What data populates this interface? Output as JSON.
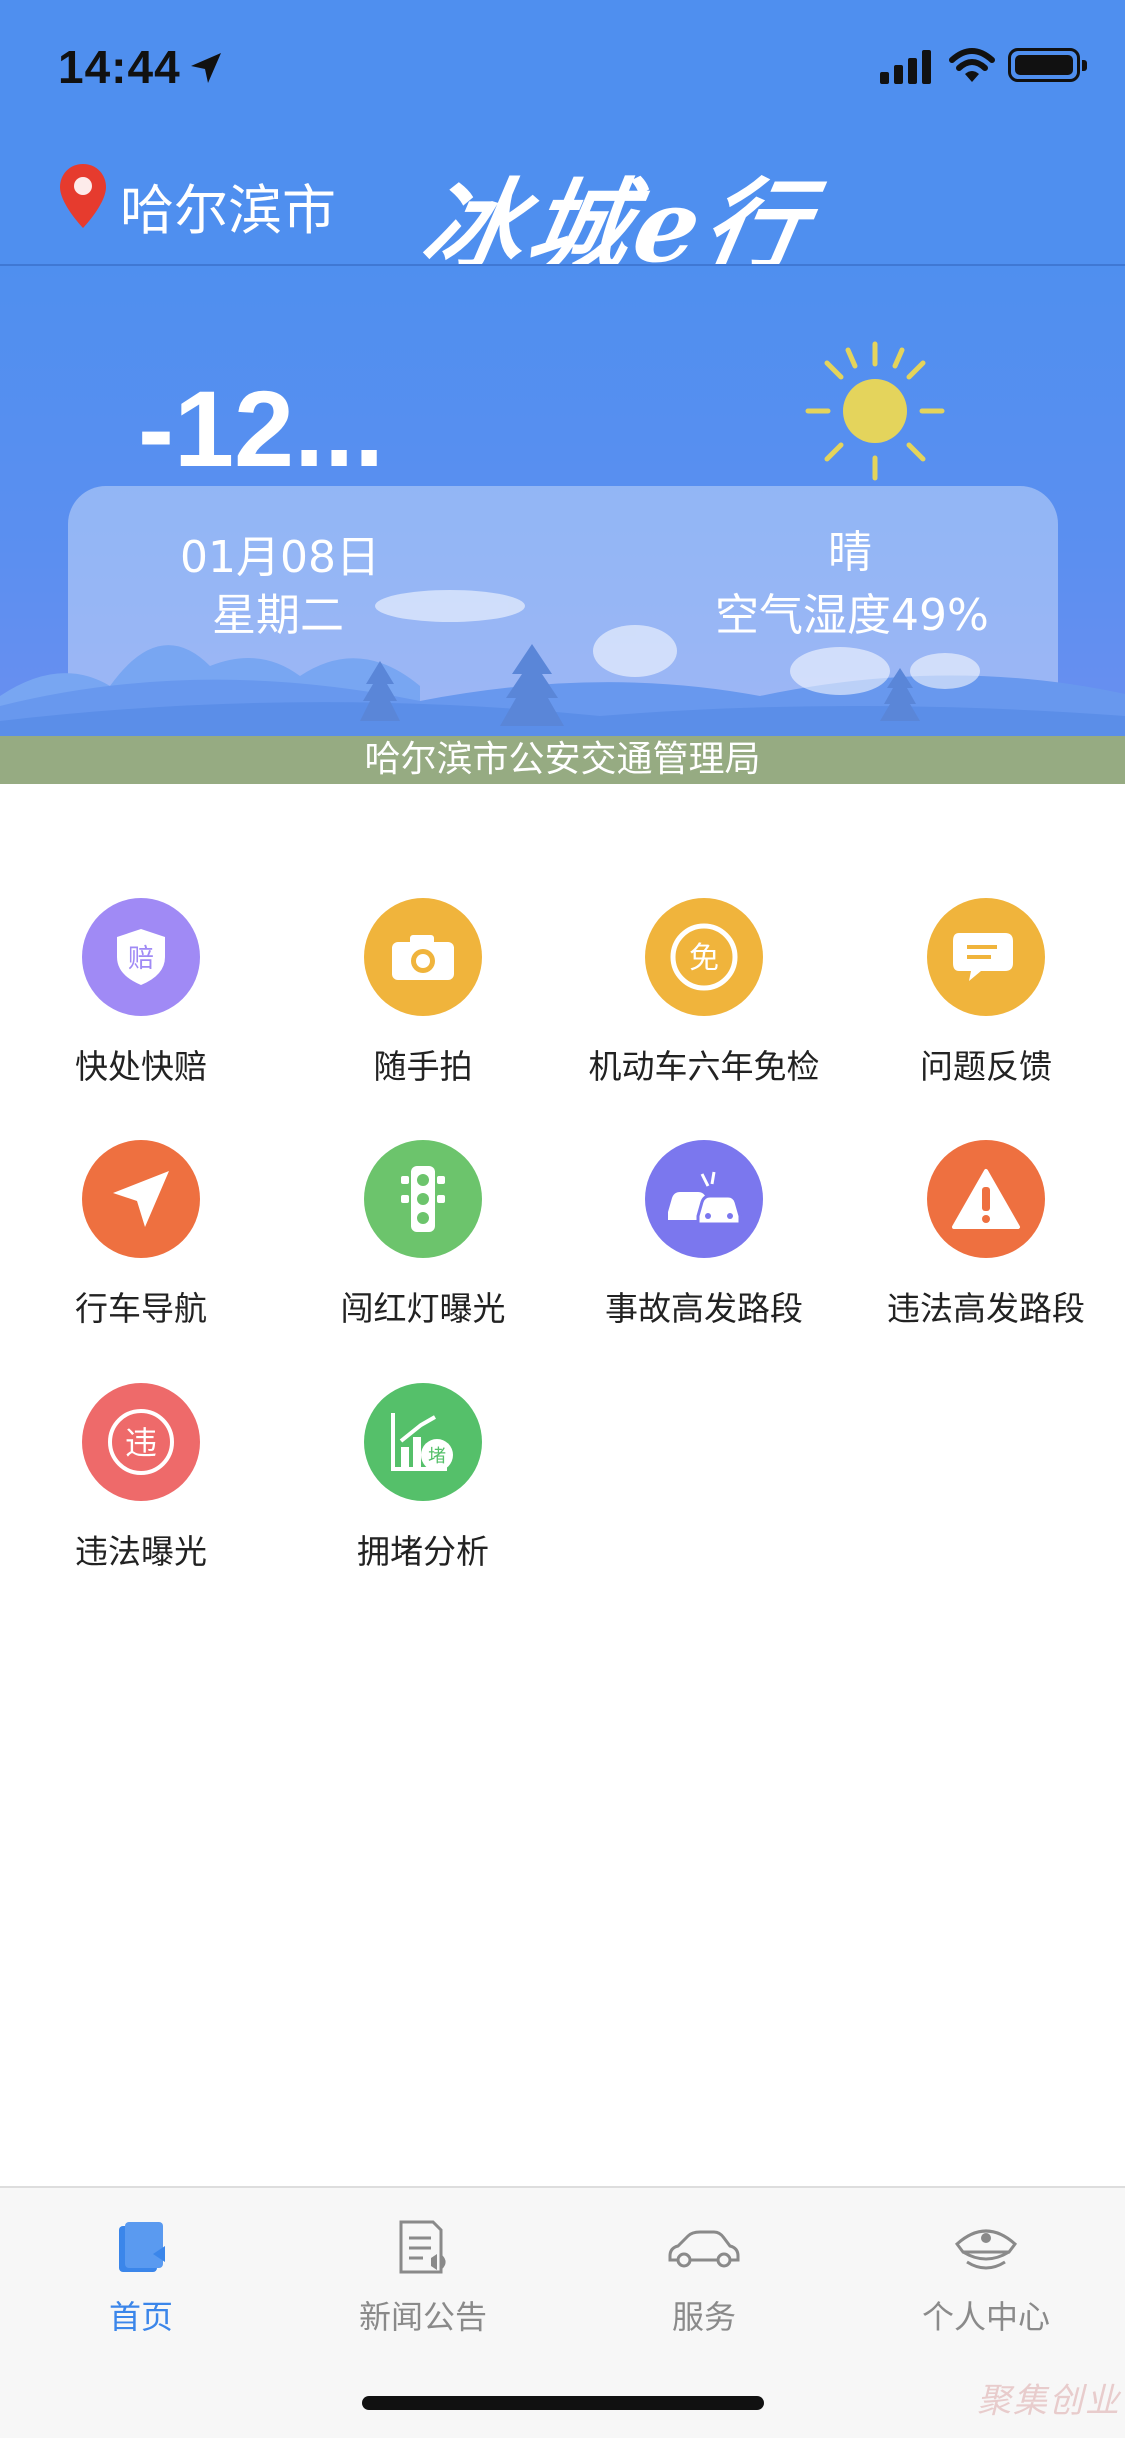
{
  "status_bar": {
    "time": "14:44"
  },
  "header": {
    "city": "哈尔滨市",
    "app_title": "冰城e行"
  },
  "weather": {
    "temperature": "-12...",
    "date": "01月08日",
    "weekday": "星期二",
    "condition": "晴",
    "humidity": "空气湿度49%"
  },
  "banner": {
    "text": "哈尔滨市公安交通管理局"
  },
  "features": [
    {
      "label": "快处快赔",
      "icon": "shield-compensation-icon",
      "color": "#a08af5"
    },
    {
      "label": "随手拍",
      "icon": "camera-icon",
      "color": "#f0b43c"
    },
    {
      "label": "机动车六年免检",
      "icon": "exemption-badge-icon",
      "color": "#f0b43c"
    },
    {
      "label": "问题反馈",
      "icon": "chat-feedback-icon",
      "color": "#f0b43c"
    },
    {
      "label": "行车导航",
      "icon": "navigation-arrow-icon",
      "color": "#ee7040"
    },
    {
      "label": "闯红灯曝光",
      "icon": "traffic-light-icon",
      "color": "#6cc46c"
    },
    {
      "label": "事故高发路段",
      "icon": "car-crash-icon",
      "color": "#7b77ee"
    },
    {
      "label": "违法高发路段",
      "icon": "warning-triangle-icon",
      "color": "#ee7040"
    },
    {
      "label": "违法曝光",
      "icon": "violation-icon",
      "color": "#ee6a6a"
    },
    {
      "label": "拥堵分析",
      "icon": "congestion-chart-icon",
      "color": "#55c06a"
    }
  ],
  "tabbar": [
    {
      "label": "首页",
      "icon": "home-book-icon",
      "active": true
    },
    {
      "label": "新闻公告",
      "icon": "news-document-icon",
      "active": false
    },
    {
      "label": "服务",
      "icon": "car-service-icon",
      "active": false
    },
    {
      "label": "个人中心",
      "icon": "police-cap-icon",
      "active": false
    }
  ],
  "watermark": "聚集创业",
  "colors": {
    "header_blue": "#4f8fef",
    "banner_green": "#96ab82",
    "tab_active": "#3b86ea"
  }
}
